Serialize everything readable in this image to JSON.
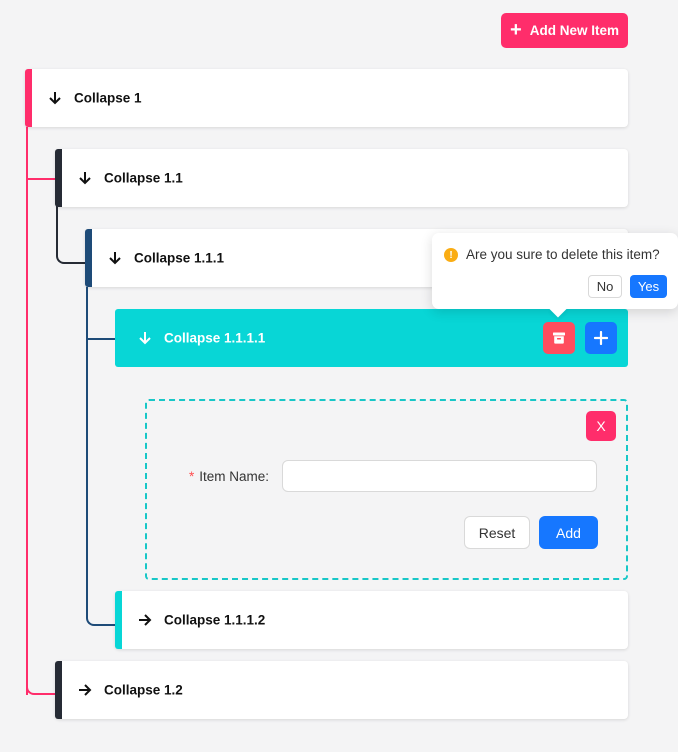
{
  "colors": {
    "pink": "#ff2d6b",
    "dark": "#262b35",
    "navy": "#1e4b78",
    "cyan": "#08d6d6",
    "red": "#ff4d5e",
    "blue": "#1677ff",
    "warning": "#faad14"
  },
  "toolbar": {
    "add_new_label": "Add New Item"
  },
  "tree": {
    "items": [
      {
        "title": "Collapse 1",
        "expanded": true,
        "icon": "arrow-down-icon"
      },
      {
        "title": "Collapse 1.1",
        "expanded": true,
        "icon": "arrow-down-icon"
      },
      {
        "title": "Collapse 1.1.1",
        "expanded": true,
        "icon": "arrow-down-icon"
      },
      {
        "title": "Collapse 1.1.1.1",
        "expanded": true,
        "icon": "arrow-down-icon"
      },
      {
        "title": "Collapse 1.1.1.2",
        "expanded": false,
        "icon": "arrow-right-icon"
      },
      {
        "title": "Collapse 1.2",
        "expanded": false,
        "icon": "arrow-right-icon"
      }
    ]
  },
  "popconfirm": {
    "message": "Are you sure to delete this item?",
    "no_label": "No",
    "yes_label": "Yes",
    "icon": "!"
  },
  "form": {
    "close_label": "X",
    "required_mark": "*",
    "item_name_label": "Item Name:",
    "item_name_value": "",
    "reset_label": "Reset",
    "add_label": "Add"
  }
}
